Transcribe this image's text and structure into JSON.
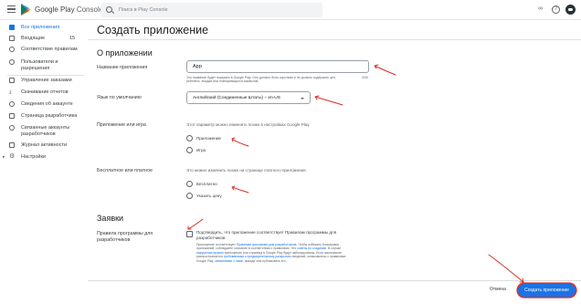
{
  "topbar": {
    "brand_google_play": "Google Play",
    "brand_console": "Console",
    "search_placeholder": "Поиск в Play Console",
    "icons": [
      "menu-icon",
      "google-play-logo-icon",
      "search-icon",
      "infinity-icon",
      "help-icon",
      "avatar"
    ]
  },
  "sidebar": {
    "items": [
      {
        "label": "Все приложения",
        "active": true
      },
      {
        "label": "Входящие",
        "count": "15"
      },
      {
        "label": "Соответствие правилам"
      },
      {
        "label": "Пользователи и разрешения"
      },
      {
        "label": "Управление заказами"
      },
      {
        "label": "Скачивание отчетов"
      },
      {
        "label": "Сведения об аккаунте"
      },
      {
        "label": "Страница разработчика"
      },
      {
        "label": "Связанные аккаунты разработчиков"
      },
      {
        "label": "Журнал активности"
      },
      {
        "label": "Настройки"
      }
    ]
  },
  "main": {
    "page_title": "Создать приложение",
    "about_section": {
      "title": "О приложении",
      "app_name_label": "Название приложения",
      "app_name_value": "App",
      "app_name_hint": "Это название будет показано в Google Play. Оно должно быть коротким и не должно содержать цен, рейтинга, эмодзи или повторяющихся символов.",
      "app_name_counter": "3/30",
      "default_language_label": "Язык по умолчанию",
      "default_language_value": "Английский (Соединенные Штаты) – en-US",
      "app_or_game_label": "Приложение или игра",
      "app_or_game_desc": "Этот параметр можно изменить позже в настройках Google Play.",
      "app_option": "Приложение",
      "game_option": "Игра",
      "free_or_paid_label": "Бесплатное или платное",
      "free_or_paid_desc": "Это можно изменить позже на странице платного приложения.",
      "free_option": "Бесплатно",
      "paid_option": "Указать цену"
    },
    "declarations_section": {
      "title": "Заявки",
      "dev_program_label": "Правила программы для разработчиков",
      "checkbox_label": "Подтвердить, что приложение соответствует Правилам программы для разработчиков",
      "legal_1": "Приложение соответствует ",
      "legal_link_1": "Правилам программы для разработчиков",
      "legal_2": ". Чтобы избежать блокировки приложений, соблюдайте описание в соответствии с правилами. Это ",
      "legal_link_2": "советы по созданию",
      "legal_3": ". В случае ",
      "legal_link_3": "нарушения правил",
      "legal_4": " приложение или страница в Google Play будут заблокированы. Если приложение распространяется ",
      "legal_link_4": "требованиями к предварительному раскрытию",
      "legal_5": " сведений, ознакомьтесь с правилами Google Play, ",
      "legal_link_5": "связанными с ними",
      "legal_6": ", прежде чем публиковать его."
    },
    "footer": {
      "cancel_label": "Отмена",
      "create_label": "Создать приложение"
    }
  },
  "colors": {
    "accent": "#1a73e8",
    "annotation": "#d93025"
  }
}
